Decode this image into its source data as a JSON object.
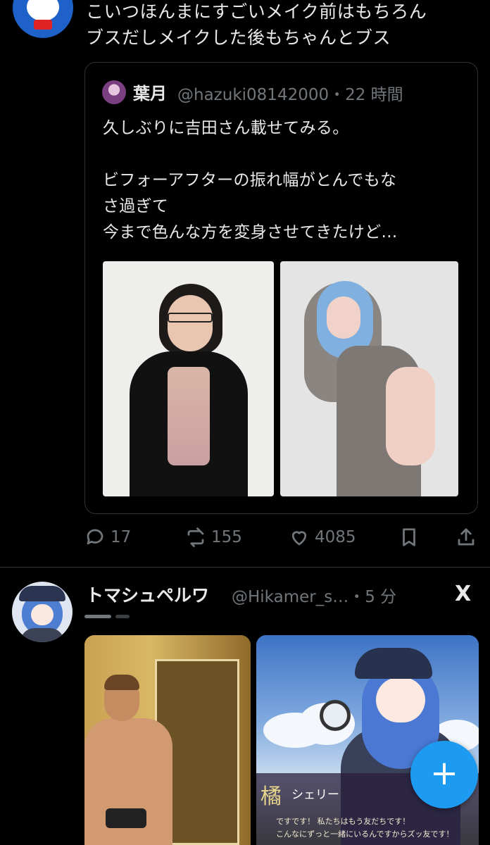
{
  "tweet1": {
    "text_line1": "こいつほんまにすごいメイク前はもちろん",
    "text_line2": "ブスだしメイクした後もちゃんとブス",
    "quote": {
      "name": "葉月",
      "handle_time": "@hazuki08142000・22 時間",
      "line1": "久しぶりに吉田さん載せてみる。",
      "line2": "ビフォーアフターの振れ幅がとんでもな",
      "line3": "さ過ぎて",
      "line4": "今まで色んな方を変身させてきたけど…"
    },
    "actions": {
      "reply_count": "17",
      "retweet_count": "155",
      "like_count": "4085",
      "icons": [
        "reply-icon",
        "retweet-icon",
        "like-icon",
        "bookmark-icon",
        "share-icon"
      ]
    }
  },
  "tweet2": {
    "name": "トマシュペルワ",
    "handle_time": "@Hikamer_s…・5 分",
    "x_logo": "X",
    "image_right": {
      "emblem": "橘",
      "character_name": "シェリー",
      "caption_line1": "ですです！ 私たちはもう友だちです！",
      "caption_line2": "こんなにずっと一緒にいるんですからズッ友です！"
    }
  },
  "fab": {
    "label": "+"
  },
  "colors": {
    "background": "#000000",
    "text": "#e7e9ea",
    "muted": "#71767b",
    "accent": "#1d9bf0",
    "border": "#2f3336"
  }
}
